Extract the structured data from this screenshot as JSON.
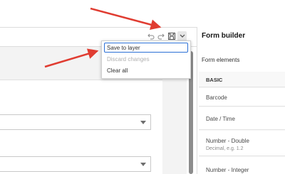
{
  "toolbar": {
    "undo_icon": "undo-icon",
    "redo_icon": "redo-icon",
    "save_icon": "save-icon",
    "menu_icon": "chevron-down-icon"
  },
  "save_menu": {
    "items": [
      {
        "label": "Save to layer",
        "state": "focused"
      },
      {
        "label": "Discard changes",
        "state": "disabled"
      },
      {
        "label": "Clear all",
        "state": "enabled"
      }
    ]
  },
  "right_panel": {
    "title": "Form builder",
    "subtitle": "Form elements",
    "section": "BASIC",
    "elements": [
      {
        "label": "Barcode",
        "description": ""
      },
      {
        "label": "Date / Time",
        "description": ""
      },
      {
        "label": "Number - Double",
        "description": "Decimal, e.g. 1.2"
      },
      {
        "label": "Number - Integer",
        "description": ""
      }
    ]
  },
  "colors": {
    "annotation_arrow": "#e03c31",
    "focus_ring": "#2a6fd6",
    "canvas_background": "#f3f3f3"
  }
}
